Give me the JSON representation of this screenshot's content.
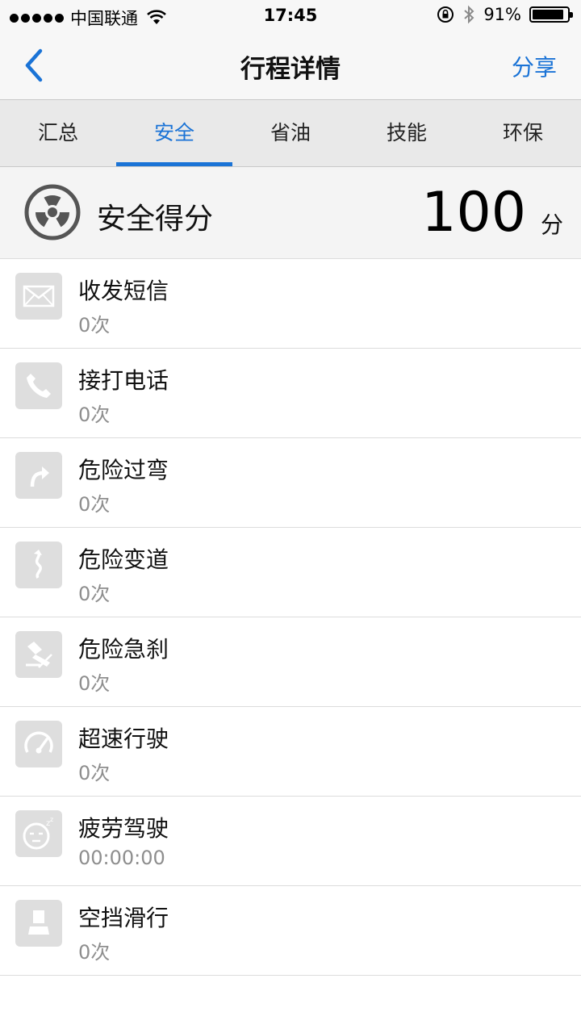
{
  "status_bar": {
    "carrier": "中国联通",
    "time": "17:45",
    "battery": "91%",
    "battery_level": 0.91
  },
  "nav": {
    "title": "行程详情",
    "share_label": "分享"
  },
  "tabs": [
    {
      "label": "汇总",
      "active": false
    },
    {
      "label": "安全",
      "active": true
    },
    {
      "label": "省油",
      "active": false
    },
    {
      "label": "技能",
      "active": false
    },
    {
      "label": "环保",
      "active": false
    }
  ],
  "score": {
    "label": "安全得分",
    "value": "100",
    "unit": "分"
  },
  "items": [
    {
      "icon": "envelope-icon",
      "title": "收发短信",
      "value": "0次"
    },
    {
      "icon": "phone-icon",
      "title": "接打电话",
      "value": "0次"
    },
    {
      "icon": "sharp-turn-icon",
      "title": "危险过弯",
      "value": "0次"
    },
    {
      "icon": "lane-change-icon",
      "title": "危险变道",
      "value": "0次"
    },
    {
      "icon": "hard-brake-icon",
      "title": "危险急刹",
      "value": "0次"
    },
    {
      "icon": "speedometer-icon",
      "title": "超速行驶",
      "value": "0次"
    },
    {
      "icon": "sleepy-face-icon",
      "title": "疲劳驾驶",
      "value": "00:00:00"
    },
    {
      "icon": "neutral-coast-icon",
      "title": "空挡滑行",
      "value": "0次"
    }
  ],
  "colors": {
    "accent": "#1a73d6",
    "icon_bg": "#dedede",
    "muted_text": "#8e8e8e"
  }
}
